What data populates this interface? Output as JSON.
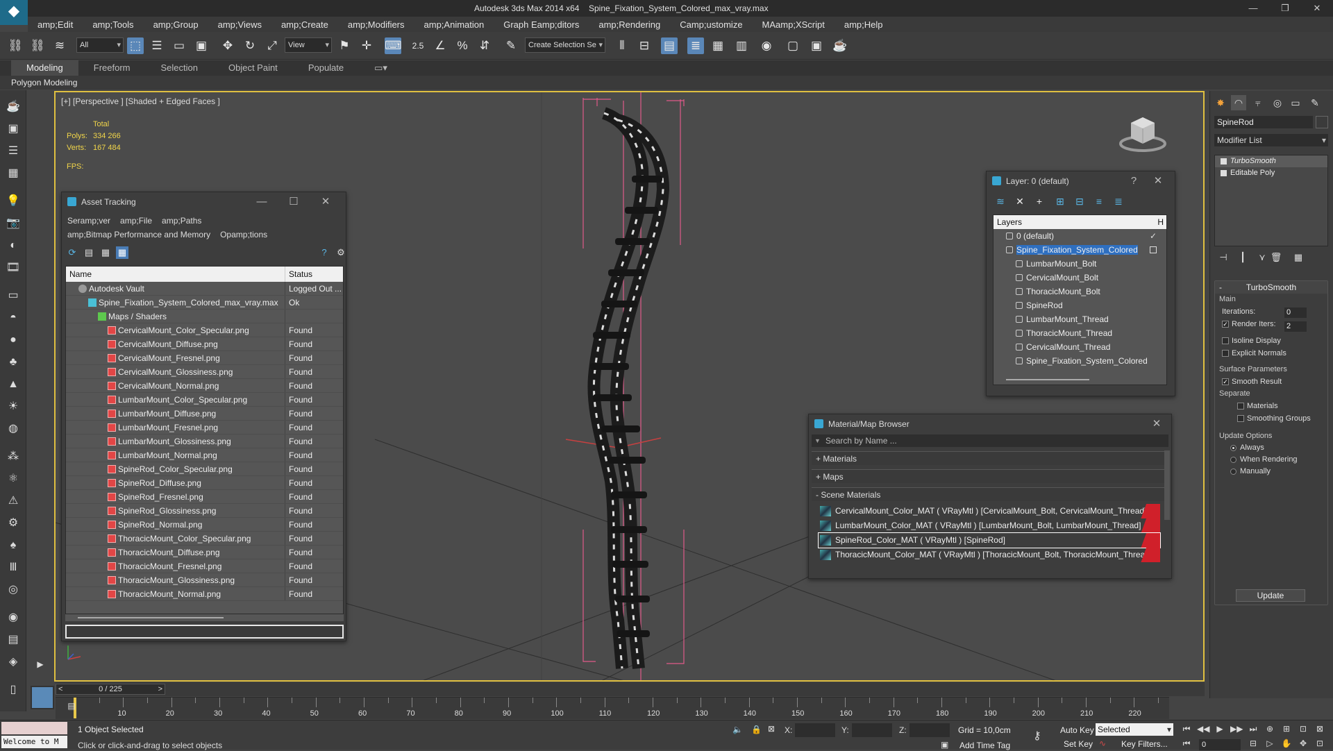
{
  "titlebar": {
    "app": "Autodesk 3ds Max  2014 x64",
    "file": "Spine_Fixation_System_Colored_max_vray.max",
    "min": "—",
    "restore": "❐",
    "close": "✕"
  },
  "menu": [
    "amp;Edit",
    "amp;Tools",
    "amp;Group",
    "amp;Views",
    "amp;Create",
    "amp;Modifiers",
    "amp;Animation",
    "Graph Eamp;ditors",
    "amp;Rendering",
    "Camp;ustomize",
    "MAamp;XScript",
    "amp;Help"
  ],
  "toolbar": {
    "filter": "All",
    "refcoord": "View",
    "selset": "Create Selection Se",
    "snap": "2.5"
  },
  "ribbon": {
    "tabs": [
      "Modeling",
      "Freeform",
      "Selection",
      "Object Paint",
      "Populate"
    ],
    "sub": "Polygon Modeling"
  },
  "viewport": {
    "label": "[+] [Perspective ] [Shaded + Edged Faces ]",
    "total": "Total",
    "polys_label": "Polys:",
    "polys": "334 266",
    "verts_label": "Verts:",
    "verts": "167 484",
    "fps_label": "FPS:"
  },
  "asset_tracking": {
    "title": "Asset Tracking",
    "menu1": [
      "Seramp;ver",
      "amp;File",
      "amp;Paths"
    ],
    "menu2": [
      "amp;Bitmap Performance and Memory",
      "Opamp;tions"
    ],
    "col_name": "Name",
    "col_status": "Status",
    "rows": [
      {
        "name": "Autodesk Vault",
        "status": "Logged Out ...",
        "icon": "vault-icon",
        "indent": 1
      },
      {
        "name": "Spine_Fixation_System_Colored_max_vray.max",
        "status": "Ok",
        "icon": "max-file-icon",
        "indent": 2
      },
      {
        "name": "Maps / Shaders",
        "status": "",
        "icon": "maps-folder-icon",
        "indent": 3
      },
      {
        "name": "CervicalMount_Color_Specular.png",
        "status": "Found",
        "icon": "png-icon",
        "indent": 4
      },
      {
        "name": "CervicalMount_Diffuse.png",
        "status": "Found",
        "icon": "png-icon",
        "indent": 4
      },
      {
        "name": "CervicalMount_Fresnel.png",
        "status": "Found",
        "icon": "png-icon",
        "indent": 4
      },
      {
        "name": "CervicalMount_Glossiness.png",
        "status": "Found",
        "icon": "png-icon",
        "indent": 4
      },
      {
        "name": "CervicalMount_Normal.png",
        "status": "Found",
        "icon": "png-icon",
        "indent": 4
      },
      {
        "name": "LumbarMount_Color_Specular.png",
        "status": "Found",
        "icon": "png-icon",
        "indent": 4
      },
      {
        "name": "LumbarMount_Diffuse.png",
        "status": "Found",
        "icon": "png-icon",
        "indent": 4
      },
      {
        "name": "LumbarMount_Fresnel.png",
        "status": "Found",
        "icon": "png-icon",
        "indent": 4
      },
      {
        "name": "LumbarMount_Glossiness.png",
        "status": "Found",
        "icon": "png-icon",
        "indent": 4
      },
      {
        "name": "LumbarMount_Normal.png",
        "status": "Found",
        "icon": "png-icon",
        "indent": 4
      },
      {
        "name": "SpineRod_Color_Specular.png",
        "status": "Found",
        "icon": "png-icon",
        "indent": 4
      },
      {
        "name": "SpineRod_Diffuse.png",
        "status": "Found",
        "icon": "png-icon",
        "indent": 4
      },
      {
        "name": "SpineRod_Fresnel.png",
        "status": "Found",
        "icon": "png-icon",
        "indent": 4
      },
      {
        "name": "SpineRod_Glossiness.png",
        "status": "Found",
        "icon": "png-icon",
        "indent": 4
      },
      {
        "name": "SpineRod_Normal.png",
        "status": "Found",
        "icon": "png-icon",
        "indent": 4
      },
      {
        "name": "ThoracicMount_Color_Specular.png",
        "status": "Found",
        "icon": "png-icon",
        "indent": 4
      },
      {
        "name": "ThoracicMount_Diffuse.png",
        "status": "Found",
        "icon": "png-icon",
        "indent": 4
      },
      {
        "name": "ThoracicMount_Fresnel.png",
        "status": "Found",
        "icon": "png-icon",
        "indent": 4
      },
      {
        "name": "ThoracicMount_Glossiness.png",
        "status": "Found",
        "icon": "png-icon",
        "indent": 4
      },
      {
        "name": "ThoracicMount_Normal.png",
        "status": "Found",
        "icon": "png-icon",
        "indent": 4
      }
    ]
  },
  "layer_panel": {
    "title": "Layer: 0 (default)",
    "help": "?",
    "close": "✕",
    "col": "Layers",
    "col2": "H",
    "rows": [
      {
        "name": "0 (default)",
        "level": 0,
        "selected": false
      },
      {
        "name": "Spine_Fixation_System_Colored",
        "level": 0,
        "selected": true
      },
      {
        "name": "LumbarMount_Bolt",
        "level": 1,
        "selected": false
      },
      {
        "name": "CervicalMount_Bolt",
        "level": 1,
        "selected": false
      },
      {
        "name": "ThoracicMount_Bolt",
        "level": 1,
        "selected": false
      },
      {
        "name": "SpineRod",
        "level": 1,
        "selected": false
      },
      {
        "name": "LumbarMount_Thread",
        "level": 1,
        "selected": false
      },
      {
        "name": "ThoracicMount_Thread",
        "level": 1,
        "selected": false
      },
      {
        "name": "CervicalMount_Thread",
        "level": 1,
        "selected": false
      },
      {
        "name": "Spine_Fixation_System_Colored",
        "level": 1,
        "selected": false
      }
    ]
  },
  "material_browser": {
    "title": "Material/Map Browser",
    "close": "✕",
    "search_placeholder": "Search by Name ...",
    "cat_materials": "+ Materials",
    "cat_maps": "+ Maps",
    "cat_scene": "- Scene Materials",
    "items": [
      {
        "label": "CervicalMount_Color_MAT  ( VRayMtl ) [CervicalMount_Bolt, CervicalMount_Thread]",
        "selected": false
      },
      {
        "label": "LumbarMount_Color_MAT  ( VRayMtl ) [LumbarMount_Bolt, LumbarMount_Thread]",
        "selected": false
      },
      {
        "label": "SpineRod_Color_MAT  ( VRayMtl ) [SpineRod]",
        "selected": true
      },
      {
        "label": "ThoracicMount_Color_MAT  ( VRayMtl ) [ThoracicMount_Bolt, ThoracicMount_Thread]",
        "selected": false
      }
    ]
  },
  "command_panel": {
    "object_name": "SpineRod",
    "modifier_list": "Modifier List",
    "stack": [
      "TurboSmooth",
      "Editable Poly"
    ],
    "turbosmooth": {
      "title": "TurboSmooth",
      "main": "Main",
      "iterations_label": "Iterations:",
      "iterations": "0",
      "render_iters_label": "Render Iters:",
      "render_iters": "2",
      "render_iters_checked": true,
      "isoline": "Isoline Display",
      "explicit": "Explicit Normals",
      "surface": "Surface Parameters",
      "smooth_result": "Smooth Result",
      "separate": "Separate",
      "materials": "Materials",
      "smoothing_groups": "Smoothing Groups",
      "update_options": "Update Options",
      "always": "Always",
      "when_rendering": "When Rendering",
      "manually": "Manually",
      "update": "Update"
    }
  },
  "timeline": {
    "frame": "0 / 225",
    "prev": "<",
    "next": ">",
    "ticks": [
      10,
      20,
      30,
      40,
      50,
      60,
      70,
      80,
      90,
      100,
      110,
      120,
      130,
      140,
      150,
      160,
      170,
      180,
      190,
      200,
      210,
      220
    ]
  },
  "status": {
    "welcome": "Welcome to M",
    "selected_count": "1 Object Selected",
    "hint": "Click or click-and-drag to select objects",
    "x": "X:",
    "y": "Y:",
    "z": "Z:",
    "grid": "Grid = 10,0cm",
    "auto_key": "Auto Key",
    "selected": "Selected",
    "set_key": "Set Key",
    "key_filters": "Key Filters...",
    "add_time_tag": "Add Time Tag",
    "frame": "0"
  },
  "colors": {
    "viewport_border": "#e0c040",
    "stats": "#f1d54a",
    "selection": "#2e6fc0",
    "red_swatch": "#d0202a",
    "bbox": "#e05a8a"
  }
}
